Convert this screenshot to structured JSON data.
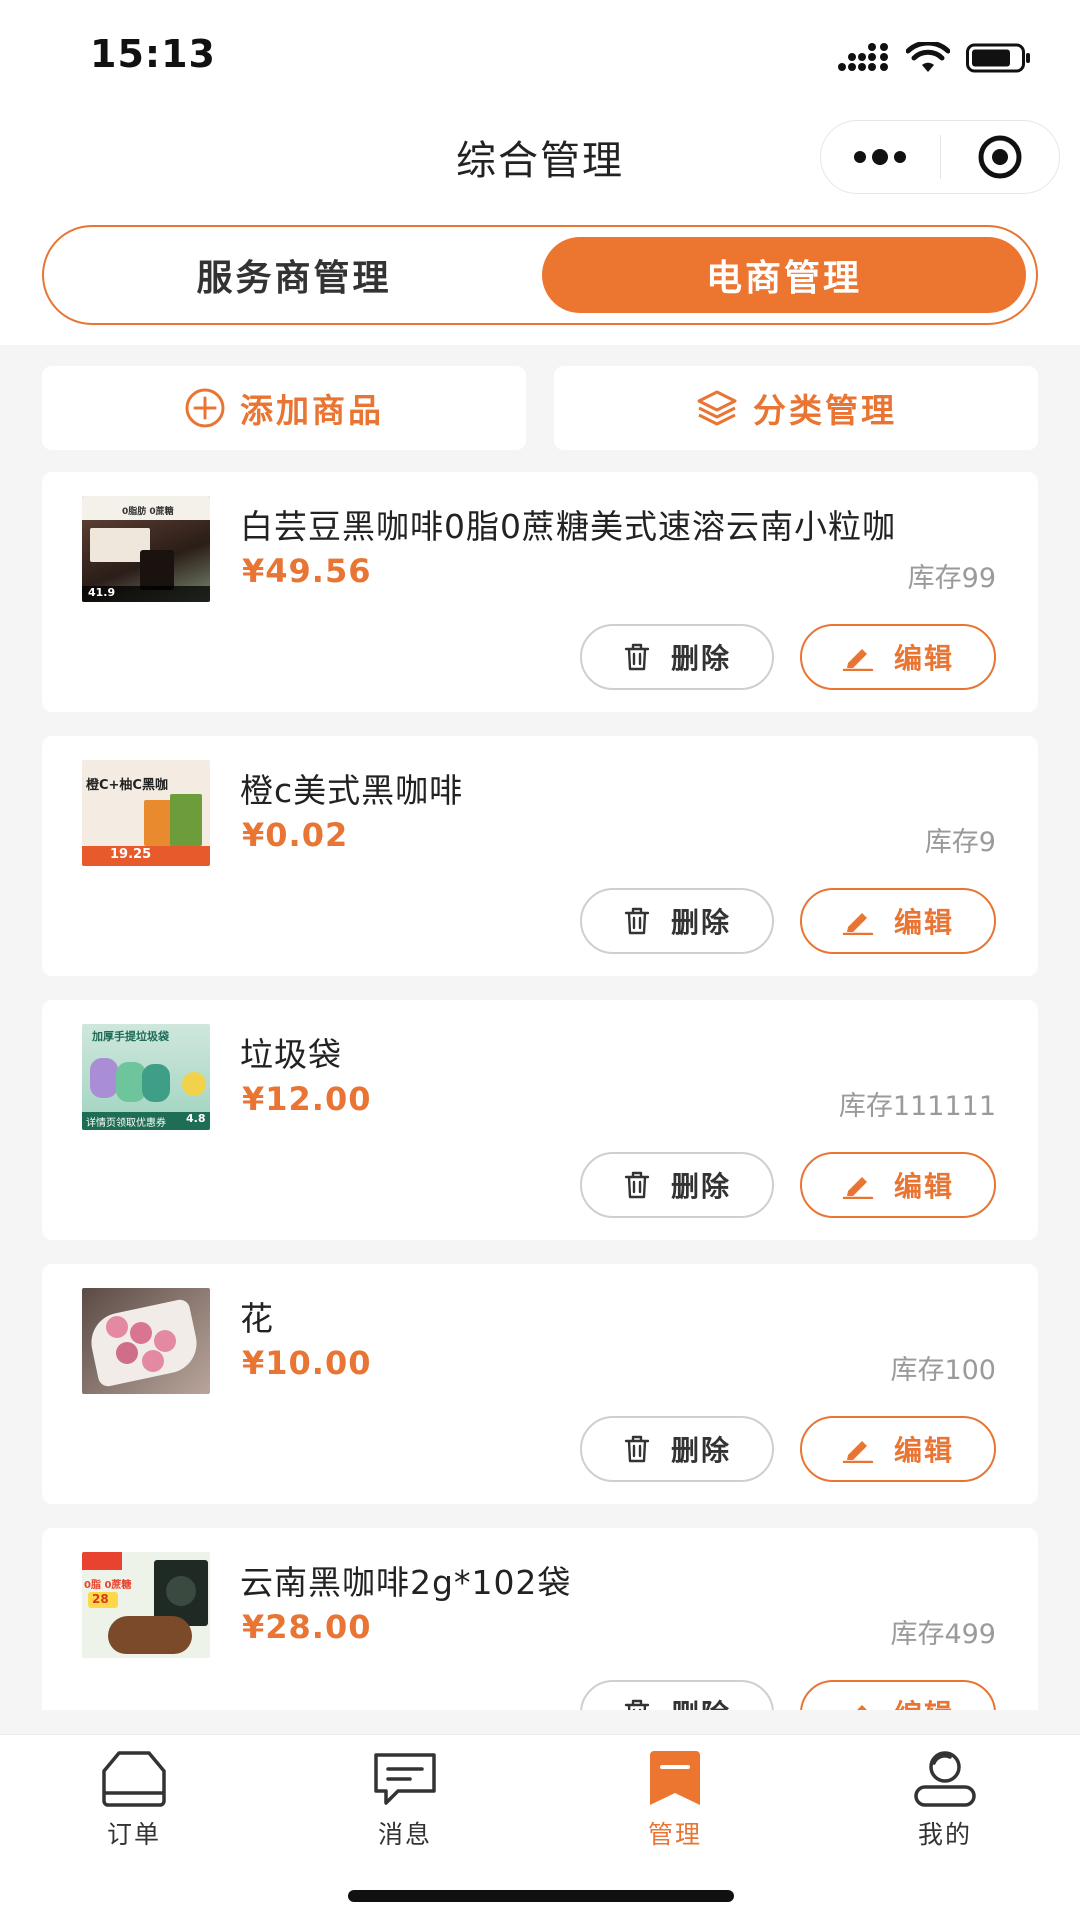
{
  "status_bar": {
    "time": "15:13"
  },
  "nav": {
    "title": "综合管理"
  },
  "segment": {
    "left_label": "服务商管理",
    "right_label": "电商管理",
    "active": "电商管理"
  },
  "actions": {
    "add_label": "添加商品",
    "category_label": "分类管理"
  },
  "products": [
    {
      "name": "白芸豆黑咖啡0脂0蔗糖美式速溶云南小粒咖",
      "price": "¥49.56",
      "stock": "库存99",
      "delete_label": "删除",
      "edit_label": "编辑",
      "thumb_texts": [
        "0脂肪 0蔗糖",
        "41.9"
      ]
    },
    {
      "name": "橙c美式黑咖啡",
      "price": "¥0.02",
      "stock": "库存9",
      "delete_label": "删除",
      "edit_label": "编辑",
      "thumb_texts": [
        "橙C+柚C黑咖",
        "19.25"
      ]
    },
    {
      "name": "垃圾袋",
      "price": "¥12.00",
      "stock": "库存111111",
      "delete_label": "删除",
      "edit_label": "编辑",
      "thumb_texts": [
        "加厚手提垃圾袋",
        "详情页领取优惠券",
        "4.8"
      ]
    },
    {
      "name": "花",
      "price": "¥10.00",
      "stock": "库存100",
      "delete_label": "删除",
      "edit_label": "编辑",
      "thumb_texts": []
    },
    {
      "name": "云南黑咖啡2g*102袋",
      "price": "¥28.00",
      "stock": "库存499",
      "delete_label": "删除",
      "edit_label": "编辑",
      "thumb_texts": [
        "0脂 0蔗糖",
        "28"
      ]
    }
  ],
  "tabs": [
    {
      "label": "订单",
      "icon": "order-icon"
    },
    {
      "label": "消息",
      "icon": "message-icon"
    },
    {
      "label": "管理",
      "icon": "manage-icon",
      "active": true
    },
    {
      "label": "我的",
      "icon": "profile-icon"
    }
  ],
  "colors": {
    "accent": "#ec7530",
    "background": "#f5f5f5",
    "price": "#e87533"
  }
}
